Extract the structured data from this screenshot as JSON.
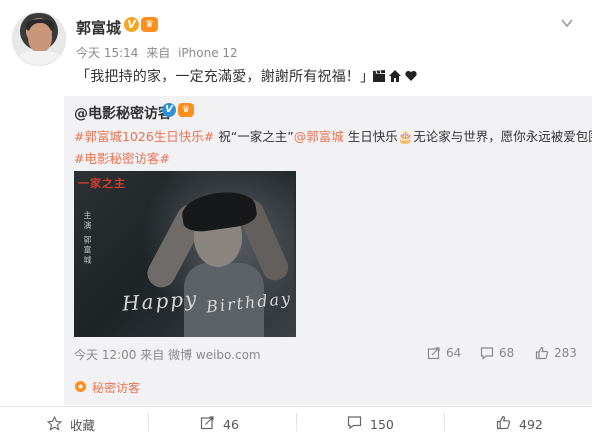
{
  "post": {
    "username": "郭富城",
    "time": "今天 15:14",
    "via": "来自",
    "device": "iPhone 12",
    "text": "「我把持的家，一定充滿愛，謝謝所有祝福！」",
    "emojis": [
      "clapper-icon",
      "house-icon",
      "heart-icon"
    ]
  },
  "repost": {
    "username": "@电影秘密访客",
    "line1_tag": "#郭富城1026生日快乐#",
    "line1_text_a": " 祝“一家之主”",
    "line1_mention": "@郭富城",
    "line1_text_b": " 生日快乐🎂无论家与世界，愿你永远被爱包围。",
    "line2_tag": "#电影秘密访客#",
    "image": {
      "corner_title": "一家之主",
      "vertical_text": "主演 郭富城",
      "script_a": "Happy",
      "script_b": "Birthday"
    },
    "time": "今天 12:00",
    "via": "来自",
    "source_app": "微博 weibo.com",
    "forwards": "64",
    "comments": "68",
    "likes": "283",
    "source_label": "秘密访客"
  },
  "actions": {
    "favorite": "收藏",
    "forward": "46",
    "comment": "150",
    "like": "492"
  },
  "colors": {
    "link": "#eb7350",
    "verified_gold": "#f7a51c",
    "verified_blue": "#2f90d9",
    "card_bg": "#f2f2f5"
  }
}
